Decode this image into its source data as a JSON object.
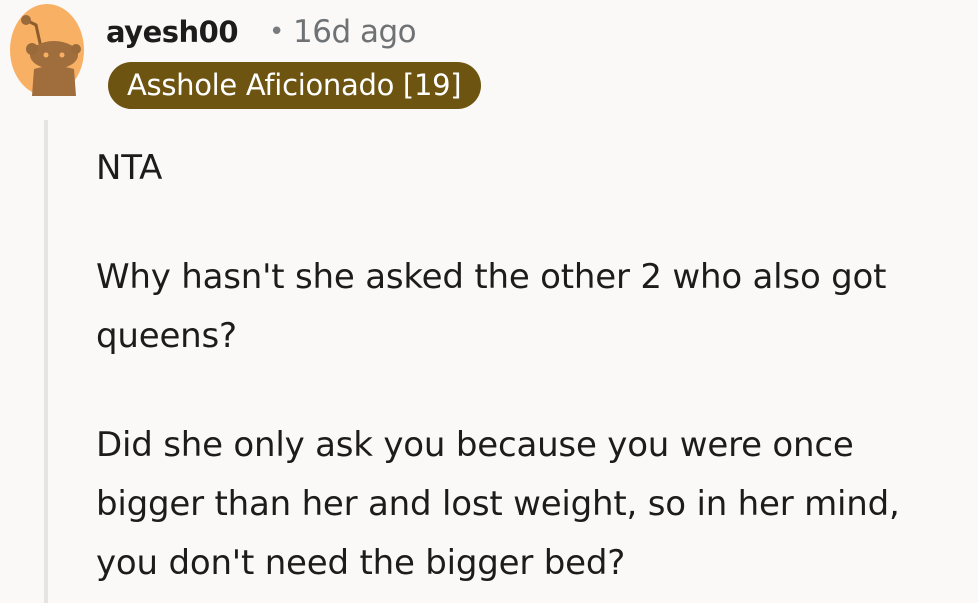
{
  "comment": {
    "author": "ayesh00",
    "separator": "•",
    "time_ago": "16d ago",
    "flair": "Asshole Aficionado [19]",
    "body": [
      "NTA",
      "Why hasn't she asked the other 2 who also got queens?",
      "Did she only ask you because you were once bigger than her and lost weight, so in her mind, you don't need the bigger bed?"
    ],
    "colors": {
      "background": "#fbf9f8",
      "flair_bg": "#6d5411",
      "avatar_bg": "#f8b065",
      "avatar_figure": "#9a6a3a"
    },
    "avatar_icon": "snoo-avatar-icon"
  }
}
